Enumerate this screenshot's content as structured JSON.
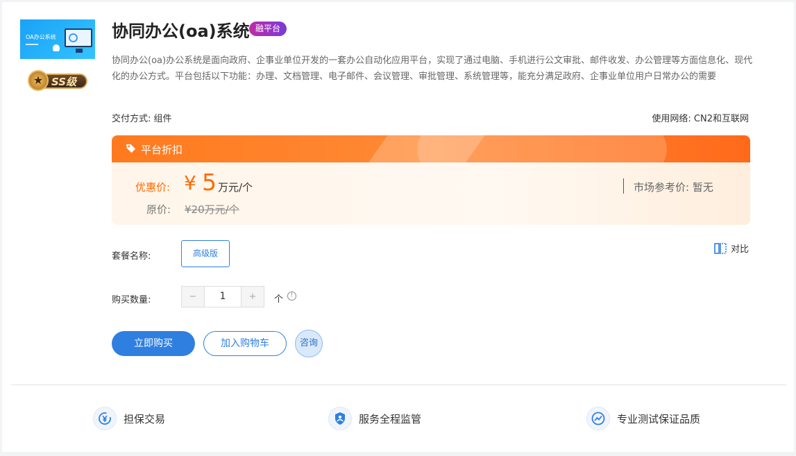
{
  "product": {
    "thumb_label": "OA办公系统",
    "level_badge": "SS级",
    "title": "协同办公(oa)系统",
    "platform_tag": "融平台",
    "description": "协同办公(oa)办公系统是面向政府、企事业单位开发的一套办公自动化应用平台，实现了通过电脑、手机进行公文审批、邮件收发、办公管理等方面信息化、现代化的办公方式。平台包括以下功能：办理、文档管理、电子邮件、会议管理、审批管理、系统管理等，能充分满足政府、企事业单位用户日常办公的需要",
    "delivery": "交付方式:  组件",
    "network": "使用网络:  CN2和互联网"
  },
  "pricing": {
    "header": "平台折扣",
    "promo_label": "优惠价:",
    "currency": "¥",
    "promo_value": "5",
    "promo_unit": "万元/个",
    "original_label": "原价:",
    "original_value": "¥20万元/个",
    "market_label": "市场参考价:  暂无"
  },
  "package": {
    "label": "套餐名称:",
    "option": "高级版",
    "compare": "对比"
  },
  "quantity": {
    "label": "购买数量:",
    "minus": "−",
    "value": "1",
    "plus": "+",
    "unit": "个",
    "info": "!"
  },
  "actions": {
    "buy": "立即购买",
    "cart": "加入购物车",
    "consult": "咨询"
  },
  "features": [
    {
      "label": "担保交易",
      "icon": "yuan-shield-icon"
    },
    {
      "label": "服务全程监管",
      "icon": "supervision-icon"
    },
    {
      "label": "专业测试保证品质",
      "icon": "quality-chart-icon"
    }
  ],
  "colors": {
    "accent": "#2f7fe0",
    "price": "#ff6a00",
    "tag_gradient": [
      "#c02aa7",
      "#7a3bd9"
    ]
  }
}
